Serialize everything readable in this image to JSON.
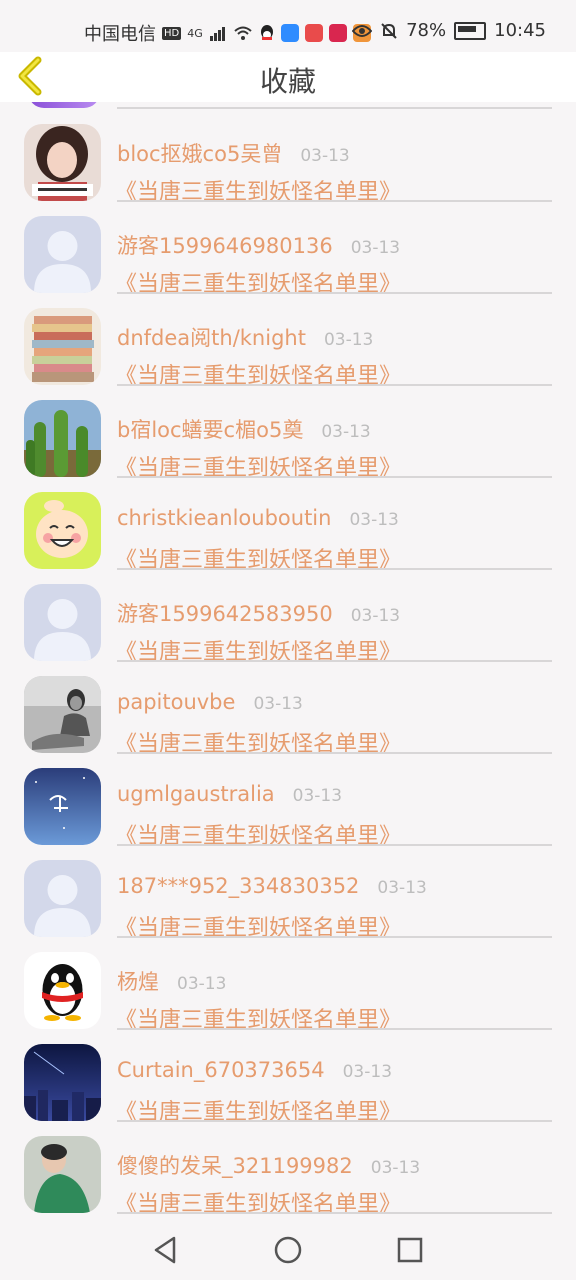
{
  "status_bar": {
    "carrier": "中国电信",
    "hd": "HD",
    "network": "4G",
    "battery": "78%",
    "time": "10:45"
  },
  "header": {
    "title": "收藏"
  },
  "colors": {
    "accent": "#e69c6e",
    "date": "#bdbdbd",
    "divider": "#d8d6d7"
  },
  "items": [
    {
      "name": "bloc抠娥co5吴曾",
      "date": "03-13",
      "book": "《当唐三重生到妖怪名单里》",
      "avatar": "girl-photo"
    },
    {
      "name": "游客1599646980136",
      "date": "03-13",
      "book": "《当唐三重生到妖怪名单里》",
      "avatar": "default-avatar"
    },
    {
      "name": "dnfdea阅th/knight",
      "date": "03-13",
      "book": "《当唐三重生到妖怪名单里》",
      "avatar": "fabric-stack"
    },
    {
      "name": "b宿loc蟮要c楣o5奠",
      "date": "03-13",
      "book": "《当唐三重生到妖怪名单里》",
      "avatar": "cactus"
    },
    {
      "name": "christkieanlouboutin",
      "date": "03-13",
      "book": "《当唐三重生到妖怪名单里》",
      "avatar": "cartoon-face"
    },
    {
      "name": "游客1599642583950",
      "date": "03-13",
      "book": "《当唐三重生到妖怪名单里》",
      "avatar": "default-avatar"
    },
    {
      "name": "papitouvbe",
      "date": "03-13",
      "book": "《当唐三重生到妖怪名单里》",
      "avatar": "bw-photo"
    },
    {
      "name": "ugmlgaustralia",
      "date": "03-13",
      "book": "《当唐三重生到妖怪名单里》",
      "avatar": "blue-sky"
    },
    {
      "name": "187***952_334830352",
      "date": "03-13",
      "book": "《当唐三重生到妖怪名单里》",
      "avatar": "default-avatar"
    },
    {
      "name": "杨煌",
      "date": "03-13",
      "book": "《当唐三重生到妖怪名单里》",
      "avatar": "qq-penguin"
    },
    {
      "name": "Curtain_670373654",
      "date": "03-13",
      "book": "《当唐三重生到妖怪名单里》",
      "avatar": "night-city"
    },
    {
      "name": "傻傻的发呆_321199982",
      "date": "03-13",
      "book": "《当唐三重生到妖怪名单里》",
      "avatar": "green-photo"
    }
  ]
}
